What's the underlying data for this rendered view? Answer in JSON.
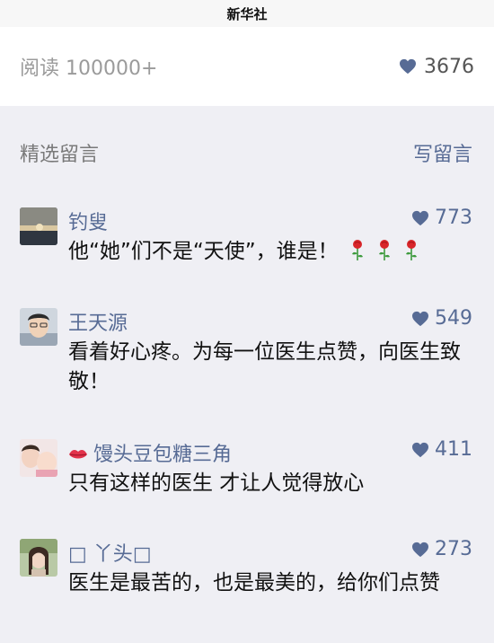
{
  "title": "新华社",
  "stats": {
    "read_label": "阅读 100000+",
    "like_count": "3676"
  },
  "section": {
    "label": "精选留言",
    "write_label": "写留言"
  },
  "comments": [
    {
      "nickname": "钓叟",
      "likes": "773",
      "text": "他“她”们不是“天使”，谁是！",
      "trailing_icons": [
        "rose-icon",
        "rose-icon",
        "rose-icon"
      ]
    },
    {
      "nickname": "王天源",
      "likes": "549",
      "text": "看着好心疼。为每一位医生点赞，向医生致敬！"
    },
    {
      "nickname": "馒头豆包糖三角",
      "nickname_icon": "lips-icon",
      "likes": "411",
      "text": "只有这样的医生 才让人觉得放心"
    },
    {
      "nickname_prefix": "□",
      "nickname": "丫头",
      "nickname_suffix": "□",
      "likes": "273",
      "text": "医生是最苦的，也是最美的，给你们点赞"
    }
  ],
  "colors": {
    "link": "#576b95",
    "muted": "#9b9b9b",
    "background": "#efeff4",
    "panel": "#ffffff"
  }
}
